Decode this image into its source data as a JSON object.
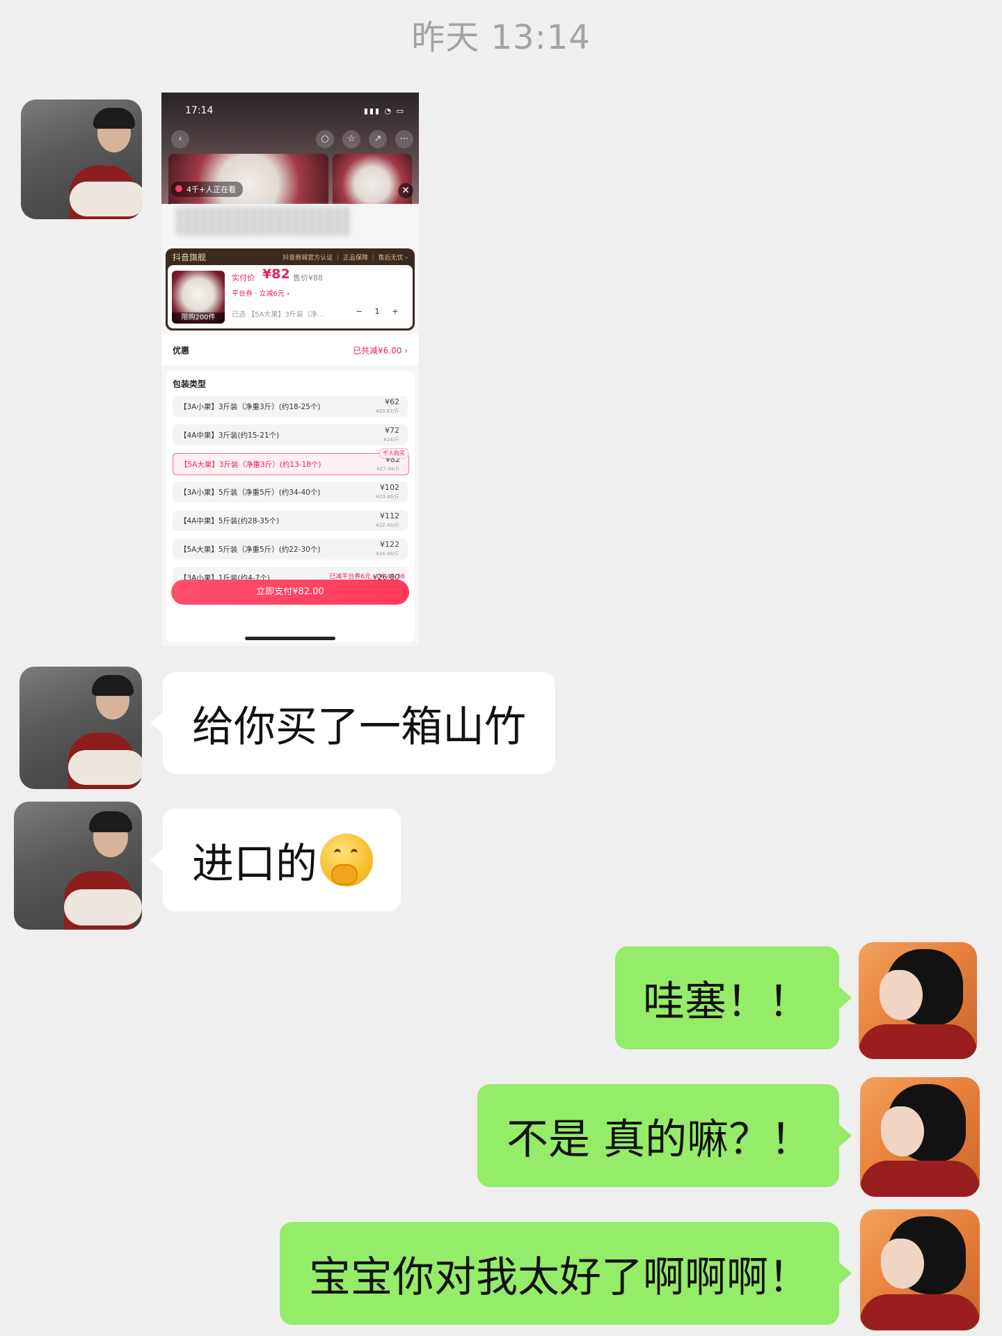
{
  "chat": {
    "timestamp": "昨天 13:14",
    "messages": [
      {
        "from": "contact",
        "type": "image"
      },
      {
        "from": "contact",
        "type": "text",
        "text": "给你买了一箱山竹"
      },
      {
        "from": "contact",
        "type": "text",
        "text": "进口的",
        "emoji": "thinking-hand-over-mouth-emoji"
      },
      {
        "from": "me",
        "type": "text",
        "text": "哇塞！！"
      },
      {
        "from": "me",
        "type": "text",
        "text": "不是 真的嘛？！"
      },
      {
        "from": "me",
        "type": "text",
        "text": "宝宝你对我太好了啊啊啊！"
      }
    ]
  },
  "shot": {
    "status_time": "17:14",
    "live_viewers": "4千+人正在看",
    "store_badge": "抖音旗舰",
    "store_guarantees": "抖音商城官方认证 ｜ 正品保障 ｜ 售后无忧 ›",
    "pay_label": "实付价",
    "pay_price": "¥82",
    "orig_price": "售价¥88",
    "coupon": "平台券 · 立减6元 ›",
    "limit": "限购200件",
    "selected": "已选 【5A大果】3斤装（净...",
    "qty": "1",
    "qty_minus": "−",
    "qty_plus": "+",
    "discount_label": "优惠",
    "discount_value": "已共减¥6.00 ›",
    "pkg_title": "包装类型",
    "options": [
      {
        "label": "【3A小果】3斤装（净重3斤）(约18-25个)",
        "price": "¥62",
        "unit": "¥20.67/斤"
      },
      {
        "label": "【4A中果】3斤装(约15-21个)",
        "price": "¥72",
        "unit": "¥24/斤"
      },
      {
        "label": "【5A大果】3斤装（净重3斤）(约13-18个)",
        "price": "¥82",
        "unit": "¥27.34/斤",
        "tag": "千人购买"
      },
      {
        "label": "【3A小果】5斤装（净重5斤）(约34-40个)",
        "price": "¥102",
        "unit": "¥20.40/斤"
      },
      {
        "label": "【4A中果】5斤装(约28-35个)",
        "price": "¥112",
        "unit": "¥22.40/斤"
      },
      {
        "label": "【5A大果】5斤装（净重5斤）(约22-30个)",
        "price": "¥122",
        "unit": "¥24.40/斤"
      },
      {
        "label": "【3A小果】1斤装(约4-7个)",
        "price": "¥26.80",
        "unit": ""
      }
    ],
    "pay_note": "已减平台券6元 · 06:45:36",
    "pay_button": "立即支付¥82.00"
  }
}
